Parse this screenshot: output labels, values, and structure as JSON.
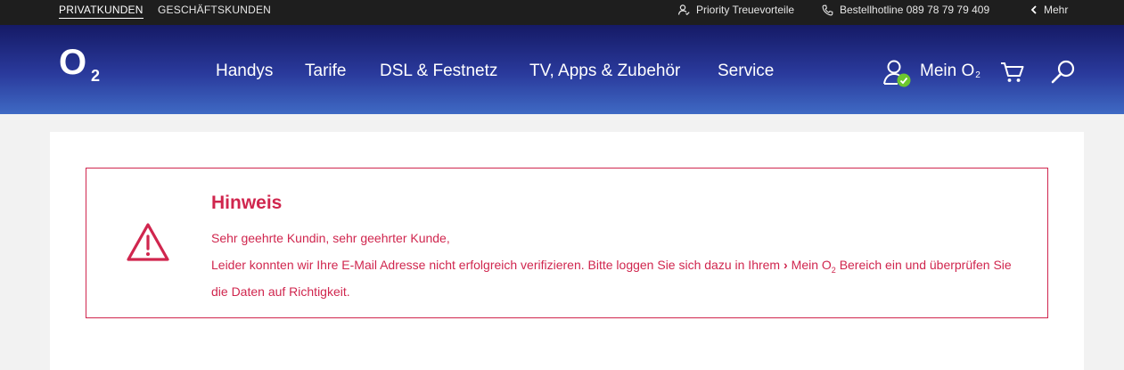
{
  "topbar": {
    "segments": [
      "PRIVATKUNDEN",
      "GESCHÄFTSKUNDEN"
    ],
    "priority": "Priority Treuevorteile",
    "hotline": "Bestellhotline 089 78 79 79 409",
    "more": "Mehr"
  },
  "header": {
    "logo_main": "O",
    "logo_sub": "2",
    "nav": [
      "Handys",
      "Tarife",
      "DSL & Festnetz",
      "TV, Apps & Zubehör",
      "Service"
    ],
    "account_label": "Mein O",
    "account_sub": "2"
  },
  "notice": {
    "title": "Hinweis",
    "greeting": "Sehr geehrte Kundin, sehr geehrter Kunde,",
    "body_before": "Leider konnten wir Ihre E-Mail Adresse nicht erfolgreich verifizieren. Bitte loggen Sie sich dazu in Ihrem",
    "link_text": "Mein O",
    "link_sub": "2",
    "body_after": "Bereich ein und überprüfen Sie die Daten auf Richtigkeit."
  },
  "colors": {
    "topbar_bg": "#1e1e1e",
    "header_gradient_top": "#151a66",
    "header_gradient_bottom": "#3f6ac4",
    "alert": "#d0264e",
    "online_badge": "#6cc72e"
  },
  "icons": [
    "person-badge-icon",
    "phone-icon",
    "chevron-left-icon",
    "user-icon",
    "cart-icon",
    "search-icon",
    "warning-triangle-icon"
  ]
}
